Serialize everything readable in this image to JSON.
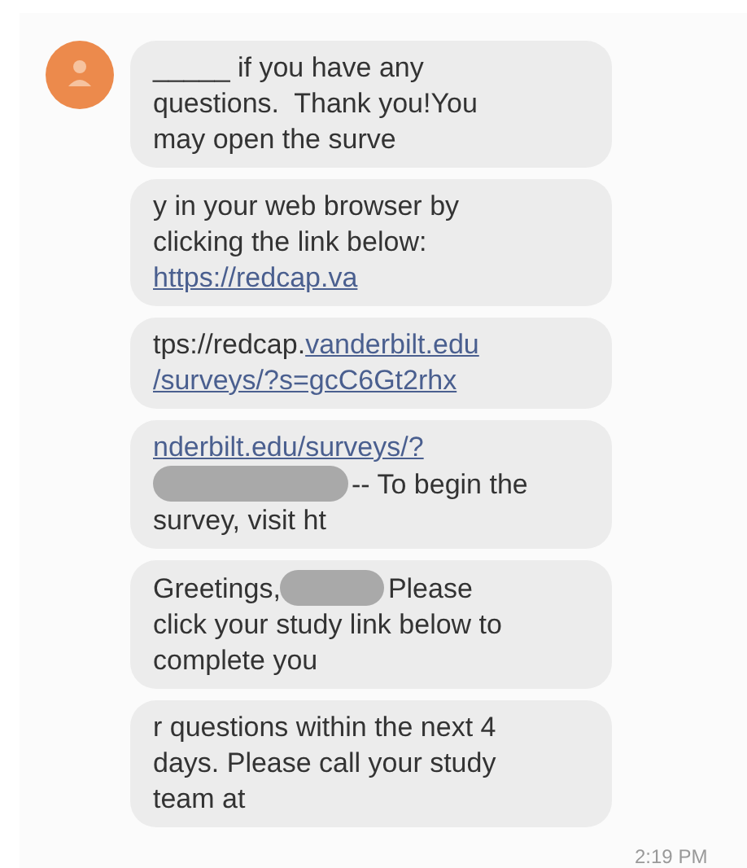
{
  "messages": [
    {
      "lines": [
        [
          {
            "kind": "text",
            "text": "_____ if you have any"
          }
        ],
        [
          {
            "kind": "text",
            "text": "questions.  Thank you!You"
          }
        ],
        [
          {
            "kind": "text",
            "text": "may open the surve"
          }
        ]
      ]
    },
    {
      "lines": [
        [
          {
            "kind": "text",
            "text": "y in your web browser by"
          }
        ],
        [
          {
            "kind": "text",
            "text": "clicking the link below:"
          }
        ],
        [
          {
            "kind": "link",
            "text": "https://redcap.va"
          }
        ]
      ]
    },
    {
      "lines": [
        [
          {
            "kind": "text",
            "text": "tps://redcap."
          },
          {
            "kind": "link",
            "text": "vanderbilt.edu"
          }
        ],
        [
          {
            "kind": "link",
            "text": "/surveys/?s=gcC6Gt2rhx"
          }
        ]
      ]
    },
    {
      "lines": [
        [
          {
            "kind": "link",
            "text": "nderbilt.edu/surveys/?"
          }
        ],
        [
          {
            "kind": "redacted"
          },
          {
            "kind": "text",
            "text": "-- To begin the"
          }
        ],
        [
          {
            "kind": "text",
            "text": "survey, visit ht"
          }
        ]
      ]
    },
    {
      "lines": [
        [
          {
            "kind": "text",
            "text": "Greetings,"
          },
          {
            "kind": "redacted"
          },
          {
            "kind": "text",
            "text": "Please"
          }
        ],
        [
          {
            "kind": "text",
            "text": "click your study link below to"
          }
        ],
        [
          {
            "kind": "text",
            "text": "complete you"
          }
        ]
      ]
    },
    {
      "lines": [
        [
          {
            "kind": "text",
            "text": "r questions within the next 4"
          }
        ],
        [
          {
            "kind": "text",
            "text": "days. Please call your study"
          }
        ],
        [
          {
            "kind": "text",
            "text": "team at"
          }
        ]
      ]
    }
  ],
  "timestamp": "2:19 PM"
}
